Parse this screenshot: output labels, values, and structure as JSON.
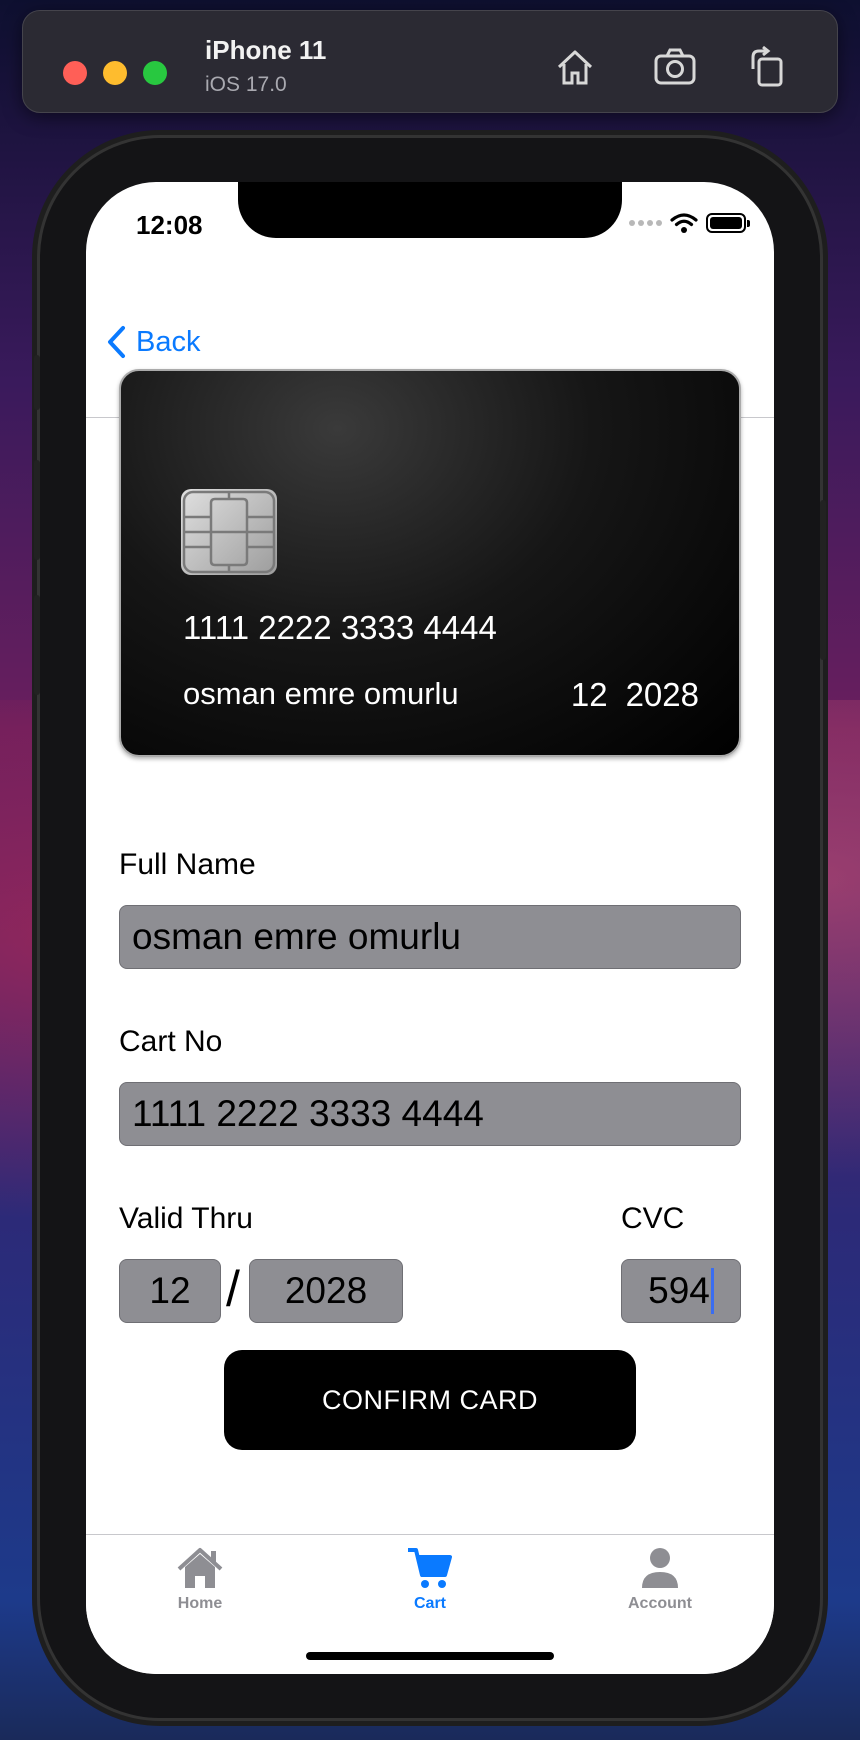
{
  "simulator": {
    "device_name": "iPhone 11",
    "os_version": "iOS 17.0",
    "toolbar_icons": [
      "home-icon",
      "screenshot-icon",
      "rotate-icon"
    ]
  },
  "status_bar": {
    "time": "12:08"
  },
  "nav": {
    "back_label": "Back"
  },
  "card_preview": {
    "number": "1111 2222 3333 4444",
    "holder": "osman emre omurlu",
    "expiry_month": "12",
    "expiry_year": "2028"
  },
  "form": {
    "full_name_label": "Full Name",
    "full_name_value": "osman emre omurlu",
    "card_no_label": "Cart No",
    "card_no_value": "1111 2222 3333 4444",
    "valid_thru_label": "Valid Thru",
    "month_value": "12",
    "separator": "/",
    "year_value": "2028",
    "cvc_label": "CVC",
    "cvc_value": "594",
    "confirm_label": "CONFIRM CARD"
  },
  "tabs": [
    {
      "label": "Home",
      "icon": "house-icon",
      "active": false
    },
    {
      "label": "Cart",
      "icon": "cart-icon",
      "active": true
    },
    {
      "label": "Account",
      "icon": "person-icon",
      "active": false
    }
  ],
  "colors": {
    "accent": "#0a7aff",
    "field_bg": "#8e8e93",
    "tab_inactive": "#8e8e93"
  }
}
